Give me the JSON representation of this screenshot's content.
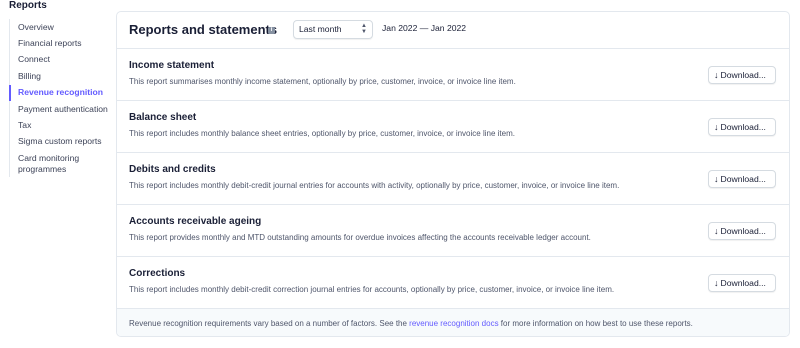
{
  "sidebar": {
    "title": "Reports",
    "items": [
      {
        "label": "Overview",
        "active": false
      },
      {
        "label": "Financial reports",
        "active": false
      },
      {
        "label": "Connect",
        "active": false
      },
      {
        "label": "Billing",
        "active": false
      },
      {
        "label": "Revenue recognition",
        "active": true
      },
      {
        "label": "Payment authentication",
        "active": false
      },
      {
        "label": "Tax",
        "active": false
      },
      {
        "label": "Sigma custom reports",
        "active": false
      },
      {
        "label": "Card monitoring programmes",
        "active": false
      }
    ]
  },
  "header": {
    "title": "Reports and statements",
    "info_icon": "info-icon",
    "period_select": "Last month",
    "date_range": "Jan 2022 — Jan 2022"
  },
  "download_label": "Download...",
  "reports": [
    {
      "name": "Income statement",
      "description": "This report summarises monthly income statement, optionally by price, customer, invoice, or invoice line item."
    },
    {
      "name": "Balance sheet",
      "description": "This report includes monthly balance sheet entries, optionally by price, customer, invoice, or invoice line item."
    },
    {
      "name": "Debits and credits",
      "description": "This report includes monthly debit-credit journal entries for accounts with activity, optionally by price, customer, invoice, or invoice line item."
    },
    {
      "name": "Accounts receivable ageing",
      "description": "This report provides monthly and MTD outstanding amounts for overdue invoices affecting the accounts receivable ledger account."
    },
    {
      "name": "Corrections",
      "description": "This report includes monthly debit-credit correction journal entries for accounts, optionally by price, customer, invoice, or invoice line item."
    }
  ],
  "footer": {
    "text_before": "Revenue recognition requirements vary based on a number of factors. See the ",
    "link": "revenue recognition docs",
    "text_after": " for more information on how best to use these reports."
  },
  "colors": {
    "accent": "#635bff",
    "text": "#1a1f36",
    "muted": "#4f566b",
    "border": "#e3e8ee"
  }
}
